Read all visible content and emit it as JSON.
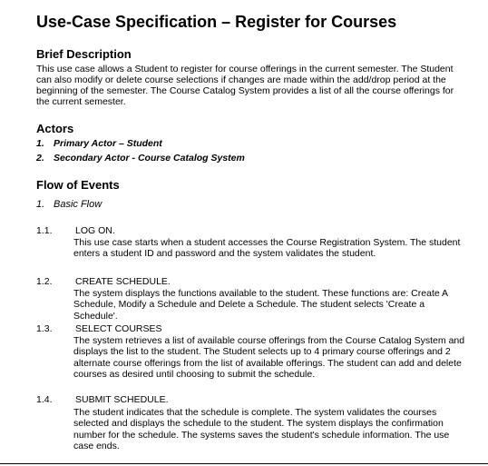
{
  "document": {
    "title": "Use-Case Specification – Register for Courses",
    "brief_description": {
      "heading": "Brief Description",
      "text": "This use case allows a Student to register for course offerings in the current semester. The Student can also modify or delete course selections if changes are made within the add/drop period at the beginning of the semester. The Course Catalog System provides a list of all the course offerings for the current semester."
    },
    "actors": {
      "heading": "Actors",
      "items": [
        {
          "num": "1.",
          "text": "Primary Actor – Student"
        },
        {
          "num": "2.",
          "text": "Secondary Actor - Course Catalog System"
        }
      ]
    },
    "flow_of_events": {
      "heading": "Flow of Events",
      "basic_flow": {
        "num": "1.",
        "label": "Basic Flow"
      },
      "steps": [
        {
          "num": "1.1.",
          "title": "LOG ON.",
          "text": "This use case starts when a student accesses the Course Registration System. The student enters a student ID and password and the system validates the student."
        },
        {
          "num": "1.2.",
          "title": "CREATE SCHEDULE.",
          "text": "The system displays the functions available to the student. These functions are: Create A Schedule, Modify a Schedule and Delete a Schedule. The student selects 'Create a Schedule'."
        },
        {
          "num": "1.3.",
          "title": "SELECT COURSES",
          "text": "The system retrieves a list of available course offerings from the Course Catalog System and displays the list to the student. The Student selects up to 4 primary course offerings and 2 alternate course offerings from the list of available offerings.  The student can add and delete courses as desired until choosing to submit the schedule."
        },
        {
          "num": "1.4.",
          "title": "SUBMIT SCHEDULE.",
          "text": "The student indicates that the schedule is complete. The system validates the courses selected and displays the schedule to the student. The system displays the confirmation number for the schedule.  The systems saves the student's schedule information. The use case ends."
        }
      ]
    }
  }
}
